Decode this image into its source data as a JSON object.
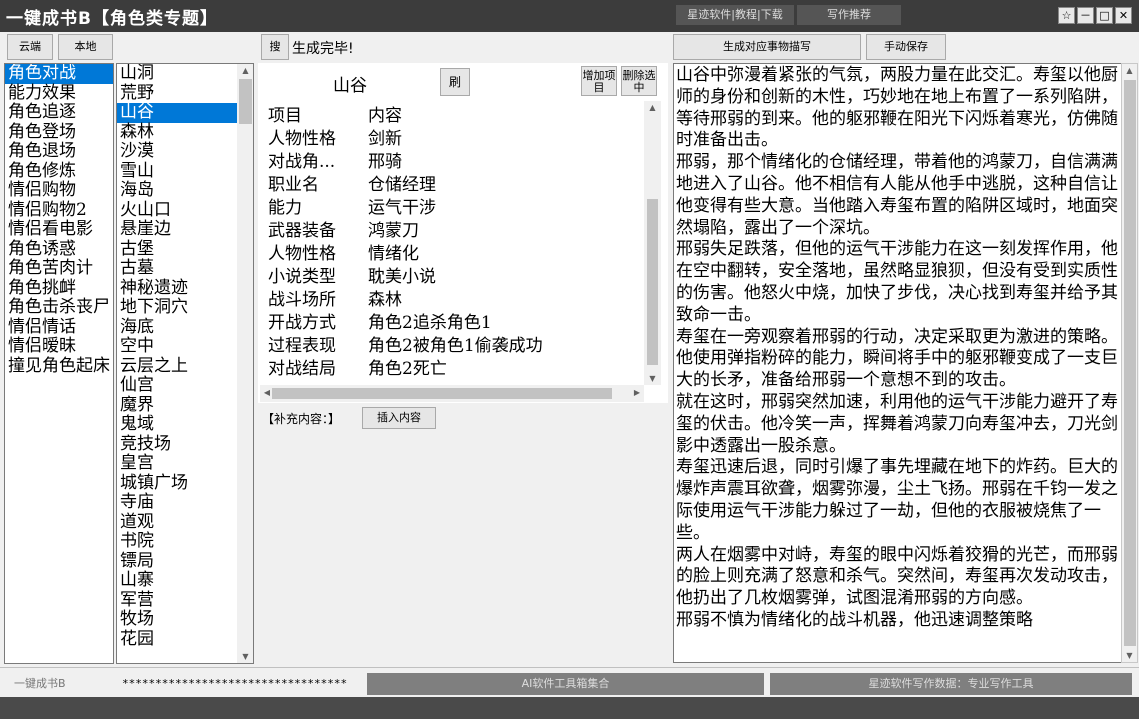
{
  "window": {
    "title": "一键成书B【角色类专题】",
    "top_link_1": "星迹软件|教程|下载",
    "top_link_2": "写作推荐",
    "pin_glyph": "☆",
    "min_glyph": "－",
    "max_glyph": "□",
    "close_glyph": "✕"
  },
  "toolbar": {
    "cloud_label": "云端",
    "local_label": "本地",
    "search_label": "搜",
    "status_text": "生成完毕!",
    "generate_label": "生成对应事物描写",
    "save_label": "手动保存"
  },
  "categories": {
    "selected_index": 0,
    "items": [
      "角色对战",
      "能力效果",
      "角色追逐",
      "角色登场",
      "角色退场",
      "角色修炼",
      "情侣购物",
      "情侣购物2",
      "情侣看电影",
      "角色诱惑",
      "角色苦肉计",
      "角色挑衅",
      "角色击杀丧尸",
      "情侣情话",
      "情侣暧昧",
      "撞见角色起床"
    ]
  },
  "locations": {
    "selected_index": 2,
    "items": [
      "山洞",
      "荒野",
      "山谷",
      "森林",
      "沙漠",
      "雪山",
      "海岛",
      "火山口",
      "悬崖边",
      "古堡",
      "古墓",
      "神秘遗迹",
      "地下洞穴",
      "海底",
      "空中",
      "云层之上",
      "仙宫",
      "魔界",
      "鬼域",
      "竞技场",
      "皇宫",
      "城镇广场",
      "寺庙",
      "道观",
      "书院",
      "镖局",
      "山寨",
      "军营",
      "牧场",
      "花园"
    ]
  },
  "detail": {
    "current_location": "山谷",
    "refresh_label": "刷",
    "add_item_label": "增加项目",
    "delete_label": "删除选中",
    "header": {
      "key": "项目",
      "value": "内容"
    },
    "rows": [
      {
        "key": "人物性格",
        "value": "剑新"
      },
      {
        "key": "对战角...",
        "value": "邢骑"
      },
      {
        "key": "职业名",
        "value": "仓储经理"
      },
      {
        "key": "能力",
        "value": "运气干涉"
      },
      {
        "key": "武器装备",
        "value": "鸿蒙刀"
      },
      {
        "key": "人物性格",
        "value": "情绪化"
      },
      {
        "key": "小说类型",
        "value": "耽美小说"
      },
      {
        "key": "战斗场所",
        "value": "森林"
      },
      {
        "key": "开战方式",
        "value": "角色2追杀角色1"
      },
      {
        "key": "过程表现",
        "value": "角色2被角色1偷袭成功"
      },
      {
        "key": "对战结局",
        "value": "角色2死亡"
      }
    ],
    "supplement_label": "【补充内容：】",
    "insert_label": "插入内容"
  },
  "story": {
    "paragraphs": [
      "山谷中弥漫着紧张的气氛，两股力量在此交汇。寿玺以他厨师的身份和创新的木性，巧妙地在地上布置了一系列陷阱，等待邢弱的到来。他的躯邪鞭在阳光下闪烁着寒光，仿佛随时准备出击。",
      "邢弱，那个情绪化的仓储经理，带着他的鸿蒙刀，自信满满地进入了山谷。他不相信有人能从他手中逃脱，这种自信让他变得有些大意。当他踏入寿玺布置的陷阱区域时，地面突然塌陷，露出了一个深坑。",
      "邢弱失足跌落，但他的运气干涉能力在这一刻发挥作用，他在空中翻转，安全落地，虽然略显狼狈，但没有受到实质性的伤害。他怒火中烧，加快了步伐，决心找到寿玺并给予其致命一击。",
      "寿玺在一旁观察着邢弱的行动，决定采取更为激进的策略。他使用弹指粉碎的能力，瞬间将手中的躯邪鞭变成了一支巨大的长矛，准备给邢弱一个意想不到的攻击。",
      "就在这时，邢弱突然加速，利用他的运气干涉能力避开了寿玺的伏击。他冷笑一声，挥舞着鸿蒙刀向寿玺冲去，刀光剑影中透露出一股杀意。",
      "寿玺迅速后退，同时引爆了事先埋藏在地下的炸药。巨大的爆炸声震耳欲聋，烟雾弥漫，尘土飞扬。邢弱在千钧一发之际使用运气干涉能力躲过了一劫，但他的衣服被烧焦了一些。",
      "两人在烟雾中对峙，寿玺的眼中闪烁着狡猾的光芒，而邢弱的脸上则充满了怒意和杀气。突然间，寿玺再次发动攻击，他扔出了几枚烟雾弹，试图混淆邢弱的方向感。",
      "邢弱不慎为情绪化的战斗机器，他迅速调整策略"
    ]
  },
  "statusbar": {
    "left_text": "一键成书B",
    "password_mask": "**********************************",
    "mid_button": "AI软件工具箱集合",
    "right_button": "星迹软件写作数据：专业写作工具"
  }
}
